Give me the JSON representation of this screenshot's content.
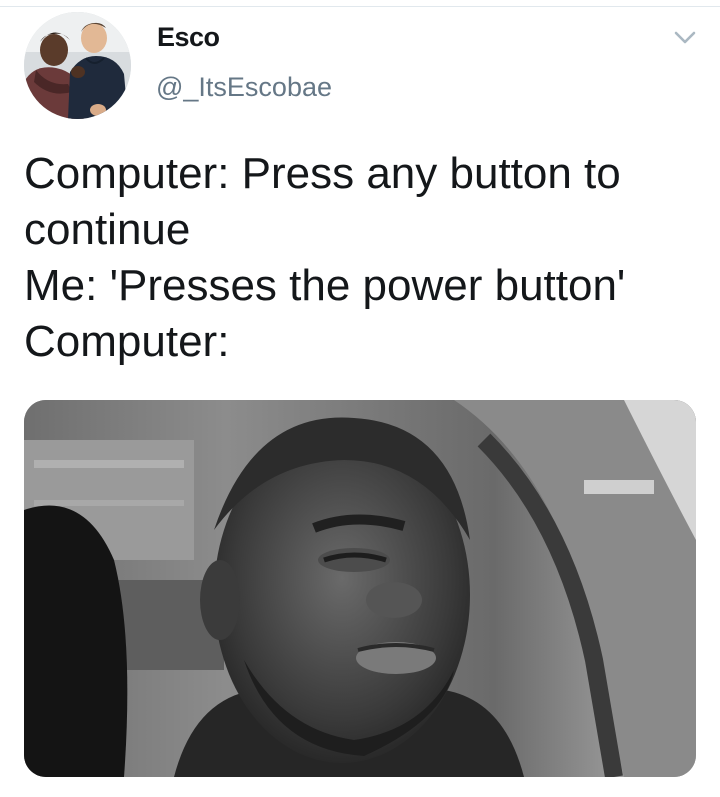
{
  "author": {
    "display_name": "Esco",
    "handle": "@_ItsEscobae",
    "avatar_icon": "avatar-photo"
  },
  "header": {
    "menu_icon": "chevron-down-icon"
  },
  "tweet": {
    "lines": [
      "Computer: Press any button to",
      "continue",
      "Me: 'Presses the power button'",
      "Computer:"
    ]
  },
  "media": {
    "type": "photo",
    "tone": "grayscale"
  },
  "colors": {
    "text": "#14171a",
    "secondary_text": "#657786",
    "divider": "#e1e8ed",
    "caret": "#aab8c2"
  }
}
